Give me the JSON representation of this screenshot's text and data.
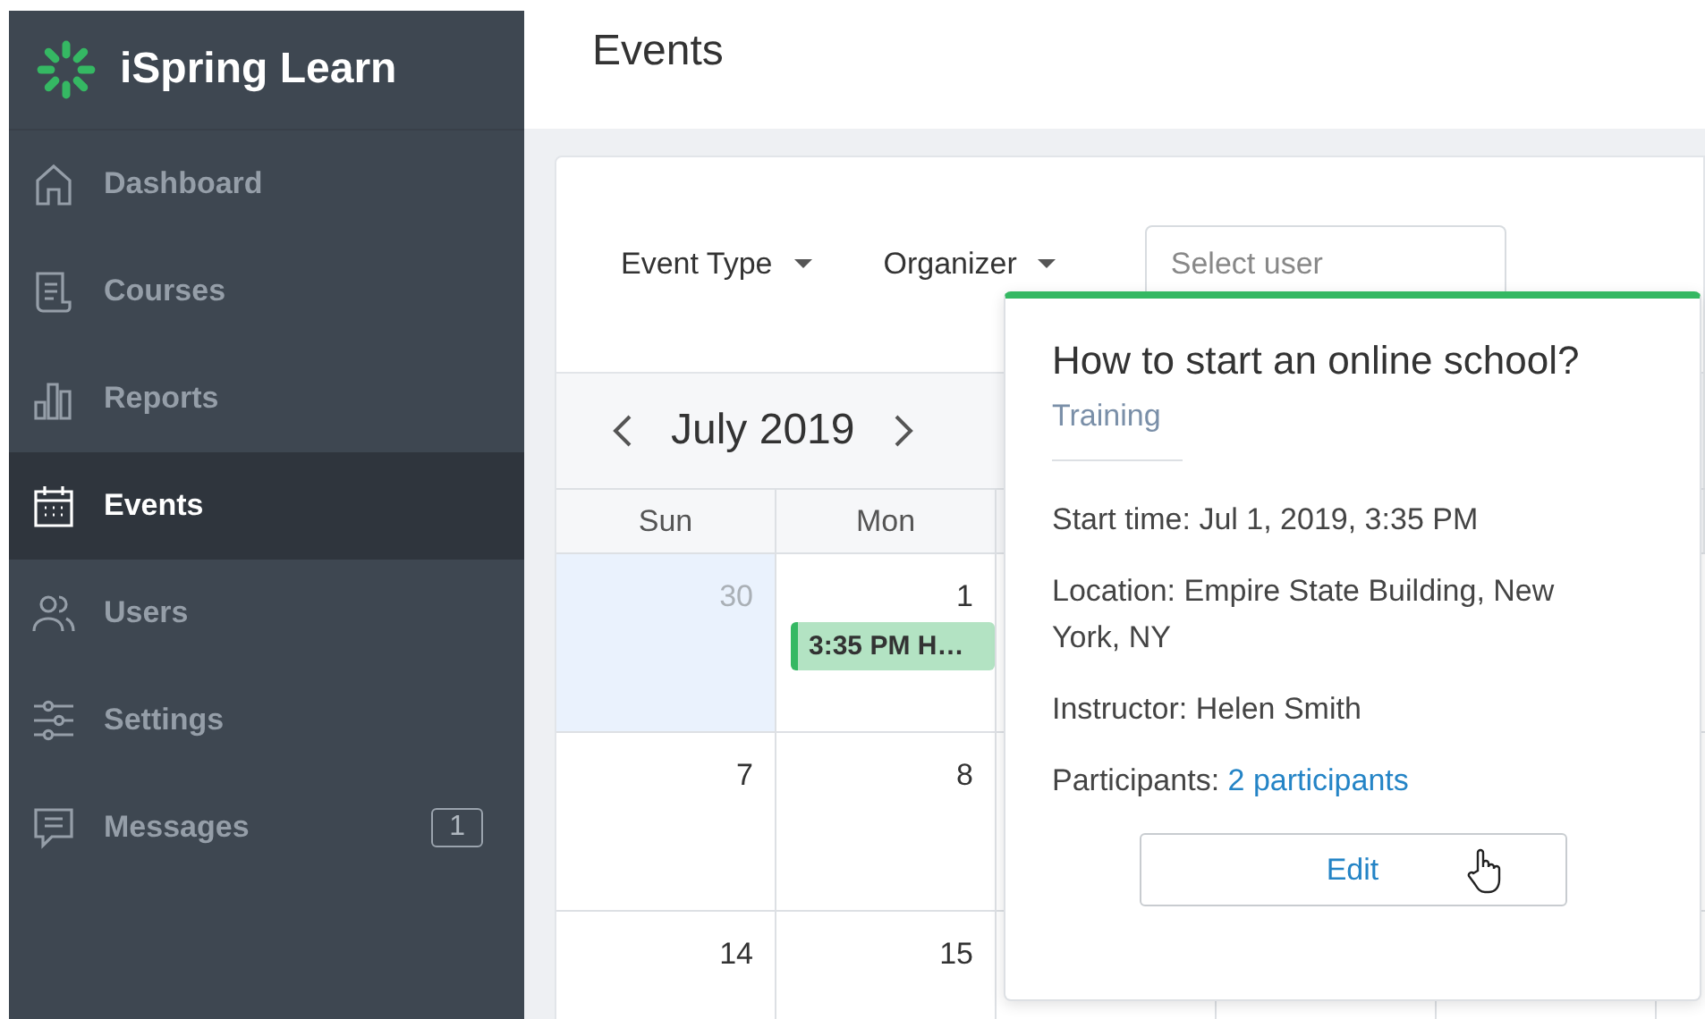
{
  "logo": {
    "text": "iSpring Learn"
  },
  "sidebar": {
    "items": [
      {
        "label": "Dashboard",
        "selected": false
      },
      {
        "label": "Courses",
        "selected": false
      },
      {
        "label": "Reports",
        "selected": false
      },
      {
        "label": "Events",
        "selected": true
      },
      {
        "label": "Users",
        "selected": false
      },
      {
        "label": "Settings",
        "selected": false
      },
      {
        "label": "Messages",
        "selected": false,
        "badge": "1"
      }
    ]
  },
  "page_title": "Events",
  "filters": [
    {
      "label": "Event Type"
    },
    {
      "label": "Organizer"
    }
  ],
  "user_field": {
    "placeholder": "Select user"
  },
  "calendar": {
    "month": "July 2019",
    "weekdays": [
      "Sun",
      "Mon"
    ],
    "weeks": [
      [
        {
          "day": "30",
          "other_month": true,
          "selected": true
        },
        {
          "day": "1",
          "other_month": false,
          "selected": false,
          "events": [
            {
              "text": "3:35 PM H…"
            }
          ]
        }
      ],
      [
        {
          "day": "7",
          "other_month": false,
          "selected": false
        },
        {
          "day": "8",
          "other_month": false,
          "selected": false
        }
      ],
      [
        {
          "day": "14",
          "other_month": false,
          "selected": false
        },
        {
          "day": "15",
          "other_month": false,
          "selected": false
        }
      ]
    ]
  },
  "popover": {
    "title": "How to start an online school?",
    "type": "Training",
    "details": [
      {
        "kind": "text",
        "label": "Start time:",
        "value": "Jul 1, 2019, 3:35 PM"
      },
      {
        "kind": "text",
        "label": "Location:",
        "value": "Empire State Building, New York, NY"
      },
      {
        "kind": "text",
        "label": "Instructor:",
        "value": "Helen Smith"
      },
      {
        "kind": "link",
        "label": "Participants:",
        "value": "2 participants"
      }
    ],
    "button": "Edit"
  }
}
